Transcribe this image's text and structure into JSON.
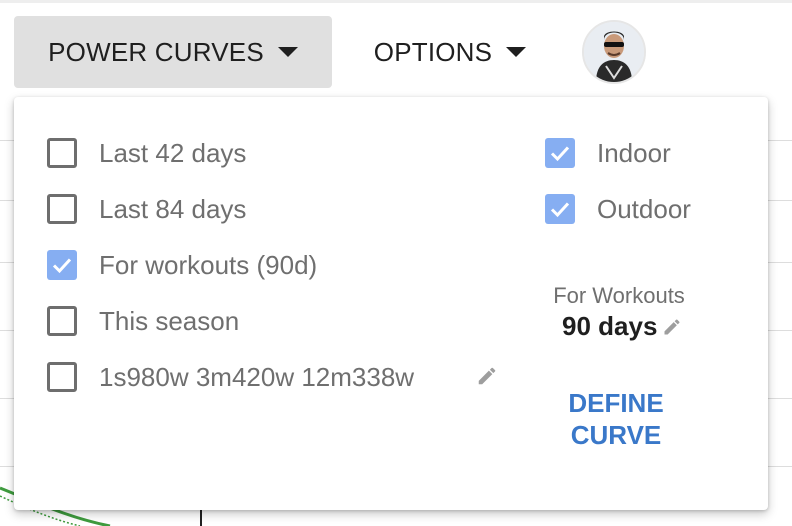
{
  "toolbar": {
    "power_curves_label": "POWER CURVES",
    "options_label": "OPTIONS"
  },
  "popup": {
    "curves": [
      {
        "label": "Last 42 days",
        "checked": false
      },
      {
        "label": "Last 84 days",
        "checked": false
      },
      {
        "label": "For workouts (90d)",
        "checked": true
      },
      {
        "label": "This season",
        "checked": false
      },
      {
        "label": "1s980w 3m420w 12m338w",
        "checked": false
      }
    ],
    "filters": [
      {
        "label": "Indoor",
        "checked": true
      },
      {
        "label": "Outdoor",
        "checked": true
      }
    ],
    "for_workouts_title": "For Workouts",
    "for_workouts_value": "90 days",
    "define_curve_label": "DEFINE CURVE"
  },
  "colors": {
    "checkbox_checked": "#86aef2",
    "accent_link": "#3a78c9",
    "menu_active_bg": "#e0e0e0"
  }
}
